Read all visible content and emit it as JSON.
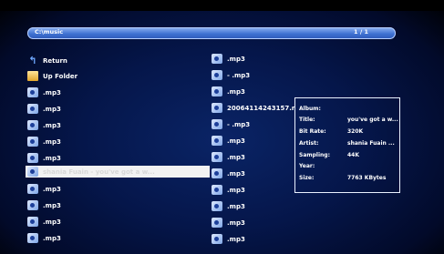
{
  "pathbar": {
    "path": "C:\\music",
    "page": "1 / 1"
  },
  "left_list": [
    {
      "label": "Return",
      "icon": "return-icon"
    },
    {
      "label": "Up Folder",
      "icon": "folder-icon"
    },
    {
      "label": ".mp3",
      "icon": "audio-file-icon"
    },
    {
      "label": ".mp3",
      "icon": "audio-file-icon"
    },
    {
      "label": ".mp3",
      "icon": "audio-file-icon"
    },
    {
      "label": ".mp3",
      "icon": "audio-file-icon"
    },
    {
      "label": ".mp3",
      "icon": "audio-file-icon"
    },
    {
      "label": "shania Fuain - you've got a w...",
      "icon": "audio-file-icon",
      "selected": true
    },
    {
      "label": ".mp3",
      "icon": "audio-file-icon"
    },
    {
      "label": ".mp3",
      "icon": "audio-file-icon"
    },
    {
      "label": ".mp3",
      "icon": "audio-file-icon"
    },
    {
      "label": ".mp3",
      "icon": "audio-file-icon"
    }
  ],
  "right_list": [
    {
      "label": ".mp3"
    },
    {
      "label": "- .mp3"
    },
    {
      "label": ".mp3"
    },
    {
      "label": "20064114243157.r"
    },
    {
      "label": "- .mp3"
    },
    {
      "label": ".mp3"
    },
    {
      "label": ".mp3"
    },
    {
      "label": ".mp3"
    },
    {
      "label": ".mp3"
    },
    {
      "label": ".mp3"
    },
    {
      "label": ".mp3"
    },
    {
      "label": ".mp3"
    }
  ],
  "info": {
    "album_label": "Album:",
    "album": "",
    "title_label": "Title:",
    "title": "you've got a w...",
    "bitrate_label": "Bit Rate:",
    "bitrate": "320K",
    "artist_label": "Artist:",
    "artist": "shania Fuain  ...",
    "sampling_label": "Sampling:",
    "sampling": "44K",
    "year_label": "Year:",
    "year": "",
    "size_label": "Size:",
    "size": "7763 KBytes"
  }
}
